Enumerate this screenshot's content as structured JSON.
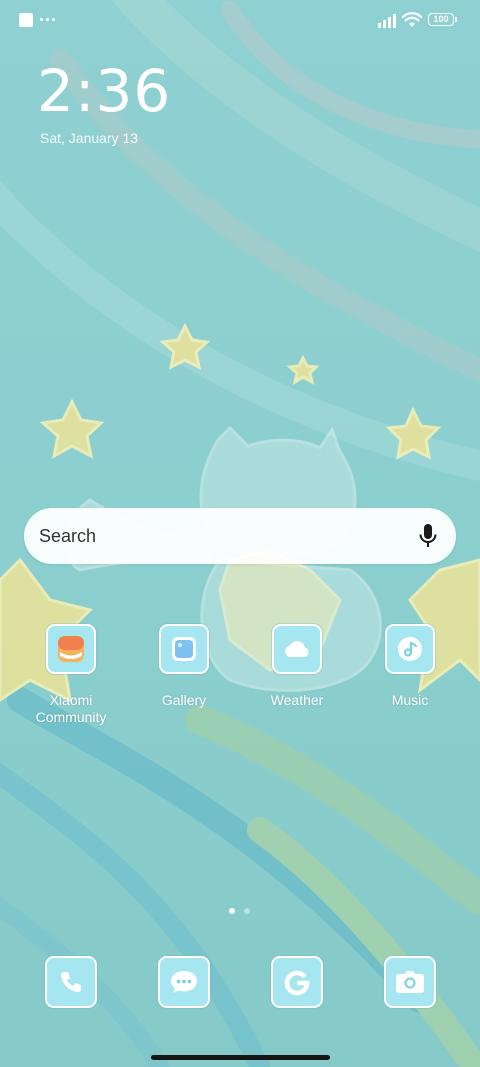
{
  "status_bar": {
    "battery_level": "100",
    "icons": [
      "notification-square-icon",
      "more-dots-icon",
      "signal-icon",
      "wifi-icon",
      "battery-icon"
    ]
  },
  "lock": {
    "time": "2:36",
    "date": "Sat, January 13"
  },
  "search": {
    "placeholder": "Search",
    "icon": "mic-icon"
  },
  "apps": [
    {
      "label": "Xiaomi Community",
      "icon": "xiaomi-community-icon"
    },
    {
      "label": "Gallery",
      "icon": "gallery-icon"
    },
    {
      "label": "Weather",
      "icon": "weather-icon"
    },
    {
      "label": "Music",
      "icon": "music-icon"
    }
  ],
  "dock": [
    {
      "name": "Phone",
      "icon": "phone-icon"
    },
    {
      "name": "Messages",
      "icon": "messages-icon"
    },
    {
      "name": "Google",
      "icon": "google-icon"
    },
    {
      "name": "Camera",
      "icon": "camera-icon"
    }
  ],
  "pager": {
    "current_page": 1,
    "total_pages": 2
  },
  "colors": {
    "wallpaper_base": "#8ecfcf",
    "icon_fill": "#a6e6f0",
    "star_yellow": "#e9e39a"
  }
}
